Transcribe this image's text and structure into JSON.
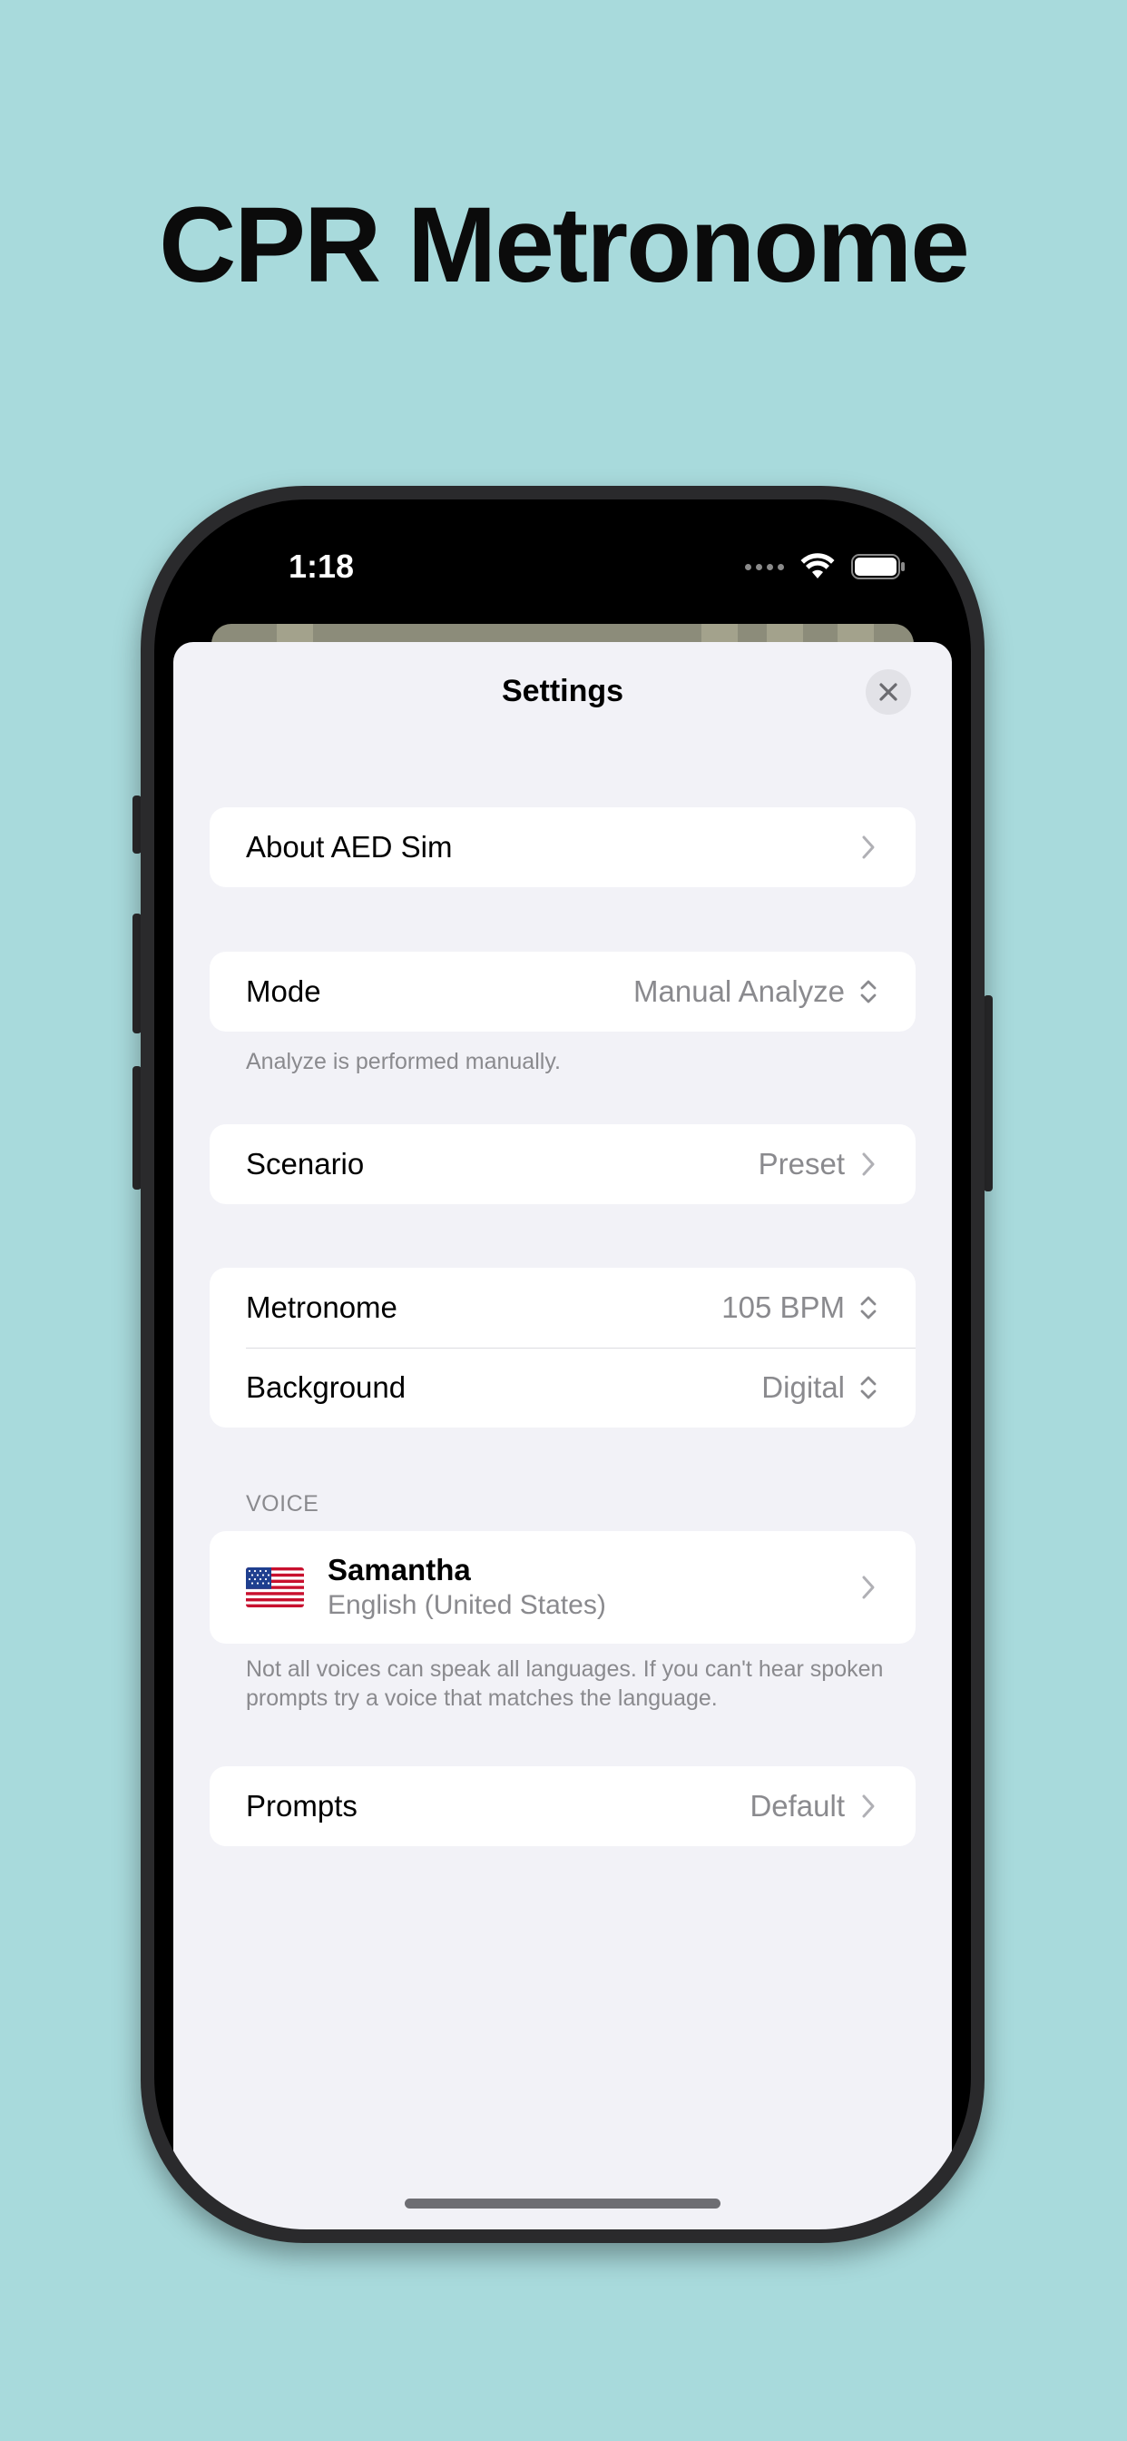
{
  "headline": "CPR Metronome",
  "status_bar": {
    "time": "1:18",
    "icons": [
      "signal-dots-icon",
      "wifi-icon",
      "battery-icon"
    ]
  },
  "sheet": {
    "title": "Settings",
    "close_icon": "close-icon"
  },
  "about": {
    "label": "About AED Sim"
  },
  "mode": {
    "label": "Mode",
    "value": "Manual Analyze",
    "footnote": "Analyze is performed manually."
  },
  "scenario": {
    "label": "Scenario",
    "value": "Preset"
  },
  "metronome": {
    "label": "Metronome",
    "value": "105 BPM"
  },
  "background": {
    "label": "Background",
    "value": "Digital"
  },
  "voice": {
    "section_header": "VOICE",
    "flag": "us-flag-icon",
    "name": "Samantha",
    "language": "English (United States)",
    "footnote": "Not all voices can speak all languages. If you can't hear spoken prompts try a voice that matches the language."
  },
  "prompts": {
    "label": "Prompts",
    "value": "Default"
  },
  "colors": {
    "page_background": "#a8dadc",
    "sheet_background": "#f2f2f7",
    "secondary_text": "#8a8a8e"
  }
}
